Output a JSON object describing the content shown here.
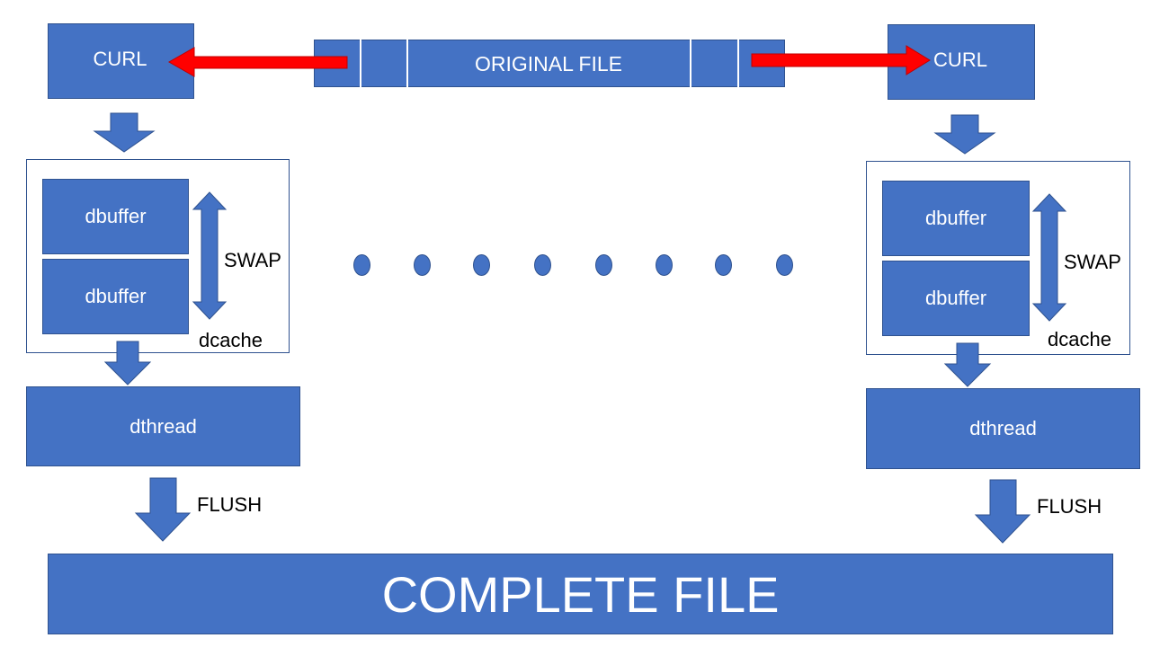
{
  "original_file": {
    "label": "ORIGINAL FILE"
  },
  "left_pipeline": {
    "curl_label": "CURL",
    "buffers": [
      "dbuffer",
      "dbuffer"
    ],
    "swap_label": "SWAP",
    "cache_label": "dcache",
    "thread_label": "dthread",
    "flush_label": "FLUSH"
  },
  "right_pipeline": {
    "curl_label": "CURL",
    "buffers": [
      "dbuffer",
      "dbuffer"
    ],
    "swap_label": "SWAP",
    "cache_label": "dcache",
    "thread_label": "dthread",
    "flush_label": "FLUSH"
  },
  "complete_file": {
    "label": "COMPLETE FILE"
  },
  "colors": {
    "box_fill": "#4472c4",
    "box_border": "#2f528f",
    "fetch_arrow": "#ff0000"
  }
}
